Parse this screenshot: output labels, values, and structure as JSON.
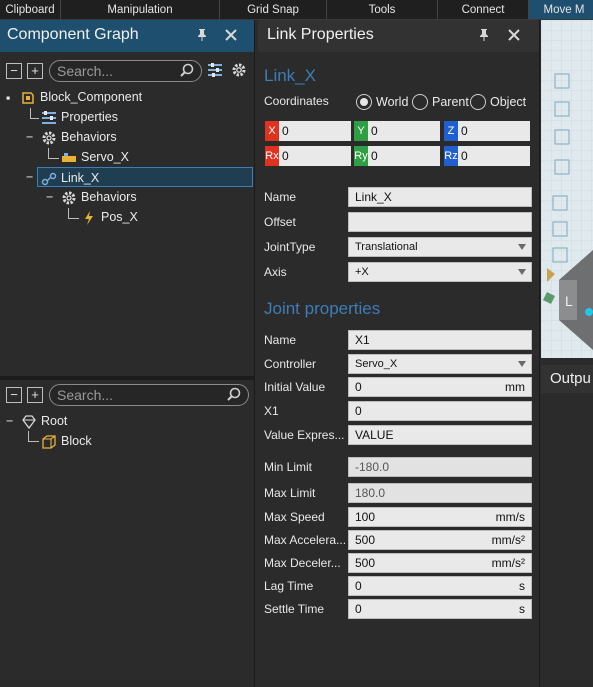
{
  "ribbon": {
    "groups": [
      "Clipboard",
      "Manipulation",
      "Grid Snap",
      "Tools",
      "Connect",
      "Move M"
    ]
  },
  "component_graph": {
    "title": "Component Graph",
    "pin_icon": "pin-icon",
    "close_icon": "close-icon",
    "search_placeholder": "Search...",
    "tree": [
      {
        "label": "Block_Component",
        "icon": "component-icon"
      },
      {
        "label": "Properties",
        "icon": "properties-icon"
      },
      {
        "label": "Behaviors",
        "icon": "gear-icon"
      },
      {
        "label": "Servo_X",
        "icon": "servo-icon"
      },
      {
        "label": "Link_X",
        "icon": "link-icon"
      },
      {
        "label": "Behaviors",
        "icon": "gear-icon"
      },
      {
        "label": "Pos_X",
        "icon": "lightning-icon"
      }
    ]
  },
  "cad_tree": {
    "search_placeholder": "Search...",
    "items": [
      {
        "label": "Root",
        "icon": "diamond-icon"
      },
      {
        "label": "Block",
        "icon": "block-icon"
      }
    ]
  },
  "link_properties": {
    "title": "Link Properties",
    "link_name": "Link_X",
    "coordinates_label": "Coordinates",
    "coord_options": [
      "World",
      "Parent",
      "Object"
    ],
    "coord_selected": "World",
    "coords": [
      {
        "tag": "X",
        "value": "0",
        "color": "#e0321e"
      },
      {
        "tag": "Y",
        "value": "0",
        "color": "#2ea043"
      },
      {
        "tag": "Z",
        "value": "0",
        "color": "#1f5fd0"
      },
      {
        "tag": "Rx",
        "value": "0",
        "color": "#e0321e"
      },
      {
        "tag": "Ry",
        "value": "0",
        "color": "#2ea043"
      },
      {
        "tag": "Rz",
        "value": "0",
        "color": "#1f5fd0"
      }
    ],
    "name_label": "Name",
    "name_value": "Link_X",
    "offset_label": "Offset",
    "offset_value": "",
    "jointtype_label": "JointType",
    "jointtype_value": "Translational",
    "axis_label": "Axis",
    "axis_value": "+X",
    "joint_section": "Joint properties",
    "joint_rows": [
      {
        "label": "Name",
        "value": "X1",
        "unit": "",
        "type": "text"
      },
      {
        "label": "Controller",
        "value": "Servo_X",
        "unit": "",
        "type": "select"
      },
      {
        "label": "Initial Value",
        "value": "0",
        "unit": "mm",
        "type": "text"
      },
      {
        "label": "X1",
        "value": "0",
        "unit": "",
        "type": "text"
      },
      {
        "label": "Value Expres...",
        "value": "VALUE",
        "unit": "",
        "type": "text"
      },
      {
        "label": "Min Limit",
        "value": "-180.0",
        "unit": "",
        "type": "readonly"
      },
      {
        "label": "Max Limit",
        "value": "180.0",
        "unit": "",
        "type": "readonly"
      },
      {
        "label": "Max Speed",
        "value": "100",
        "unit": "mm/s",
        "type": "text"
      },
      {
        "label": "Max Accelera...",
        "value": "500",
        "unit": "mm/s²",
        "type": "text"
      },
      {
        "label": "Max Deceler...",
        "value": "500",
        "unit": "mm/s²",
        "type": "text"
      },
      {
        "label": "Lag Time",
        "value": "0",
        "unit": "s",
        "type": "text"
      },
      {
        "label": "Settle Time",
        "value": "0",
        "unit": "s",
        "type": "text"
      }
    ]
  },
  "output": {
    "title": "Outpu"
  },
  "colors": {
    "accent_header": "#1f4f6e",
    "section_blue": "#3d7db8",
    "selection": "#1f3e52"
  }
}
